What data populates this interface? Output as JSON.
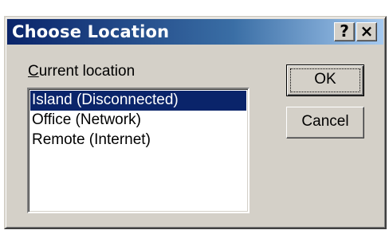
{
  "window": {
    "title": "Choose Location",
    "help_glyph": "?",
    "close_glyph": "×"
  },
  "form": {
    "label_accel": "C",
    "label_rest": "urrent location"
  },
  "locations": {
    "items": [
      {
        "label": "Island (Disconnected)",
        "selected": true
      },
      {
        "label": "Office (Network)",
        "selected": false
      },
      {
        "label": "Remote (Internet)",
        "selected": false
      }
    ]
  },
  "buttons": {
    "ok_label": "OK",
    "cancel_label": "Cancel"
  },
  "colors": {
    "dialog_face": "#d4d0c8",
    "title_gradient_start": "#0a246a",
    "title_gradient_end": "#a6caf0",
    "selection": "#0a246a"
  },
  "icons": [
    "help-icon",
    "close-icon"
  ]
}
